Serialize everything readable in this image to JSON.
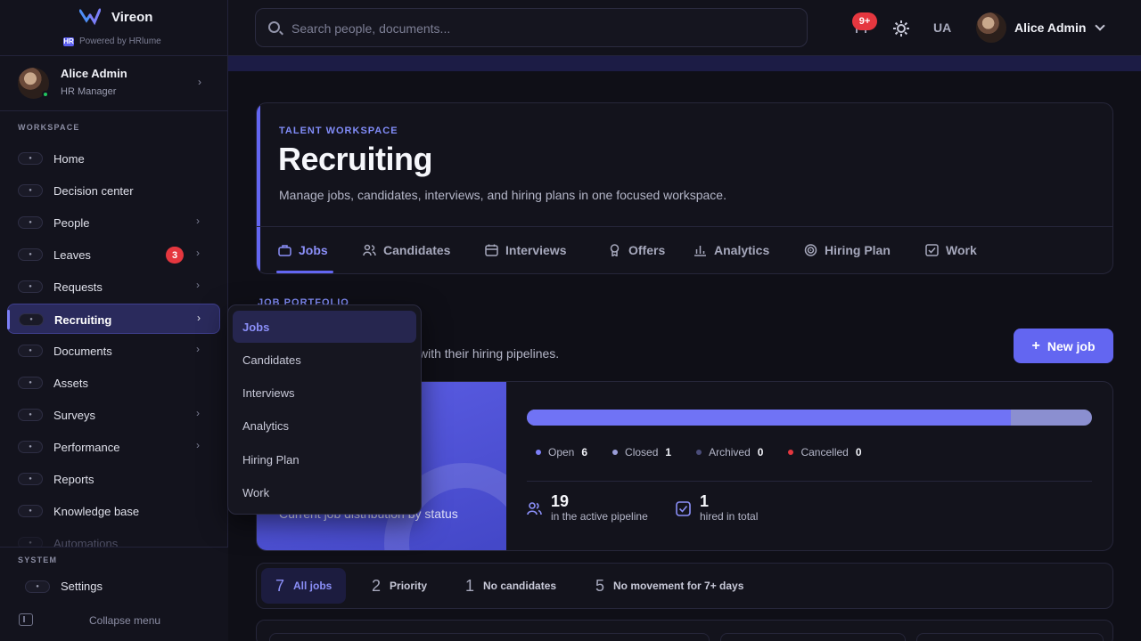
{
  "brand": {
    "name": "Vireon",
    "powered_by": "Powered by HRlume",
    "powered_icon": "HR"
  },
  "sidebar_user": {
    "name": "Alice Admin",
    "role": "HR Manager"
  },
  "workspace_label": "WORKSPACE",
  "nav": [
    {
      "label": "Home",
      "icon": "home-icon",
      "chevron": false
    },
    {
      "label": "Decision center",
      "icon": "target-icon",
      "chevron": false
    },
    {
      "label": "People",
      "icon": "people-icon",
      "chevron": true
    },
    {
      "label": "Leaves",
      "icon": "calendar-icon",
      "chevron": true,
      "badge": "3"
    },
    {
      "label": "Requests",
      "icon": "send-icon",
      "chevron": true
    },
    {
      "label": "Recruiting",
      "icon": "briefcase-icon",
      "chevron": true,
      "active": true
    },
    {
      "label": "Documents",
      "icon": "document-icon",
      "chevron": true
    },
    {
      "label": "Assets",
      "icon": "box-icon",
      "chevron": false
    },
    {
      "label": "Surveys",
      "icon": "survey-icon",
      "chevron": true
    },
    {
      "label": "Performance",
      "icon": "chart-icon",
      "chevron": true
    },
    {
      "label": "Reports",
      "icon": "report-icon",
      "chevron": false
    },
    {
      "label": "Knowledge base",
      "icon": "book-icon",
      "chevron": false
    },
    {
      "label": "Automations",
      "icon": "bolt-icon",
      "chevron": false,
      "faded": true
    }
  ],
  "system_label": "SYSTEM",
  "settings_label": "Settings",
  "collapse_label": "Collapse menu",
  "topbar": {
    "search_placeholder": "Search people, documents...",
    "notif_badge": "9+",
    "lang": "UA",
    "user_name": "Alice Admin"
  },
  "hero": {
    "eyebrow": "TALENT WORKSPACE",
    "title": "Recruiting",
    "description": "Manage jobs, candidates, interviews, and hiring plans in one focused workspace."
  },
  "tabs": [
    {
      "label": "Jobs",
      "icon": "briefcase-icon",
      "active": true
    },
    {
      "label": "Candidates",
      "icon": "people-icon"
    },
    {
      "label": "Interviews",
      "icon": "calendar-icon"
    },
    {
      "label": "Offers",
      "icon": "award-icon"
    },
    {
      "label": "Analytics",
      "icon": "bar-chart-icon"
    },
    {
      "label": "Hiring Plan",
      "icon": "target-icon"
    },
    {
      "label": "Work",
      "icon": "checkbox-icon"
    }
  ],
  "portfolio": {
    "label": "JOB PORTFOLIO",
    "description_visible": "with their hiring pipelines.",
    "new_job_label": "New job"
  },
  "summary": {
    "caption": "Current job distribution by status",
    "progress_open_fraction": 0.857,
    "legend": [
      {
        "label": "Open",
        "value": "6",
        "color": "#7c7ff8"
      },
      {
        "label": "Closed",
        "value": "1",
        "color": "#9a9dd8"
      },
      {
        "label": "Archived",
        "value": "0",
        "color": "#4b4d7a"
      },
      {
        "label": "Cancelled",
        "value": "0",
        "color": "#e5373f"
      }
    ],
    "stats": [
      {
        "value": "19",
        "label": "in the active pipeline",
        "icon": "people-icon"
      },
      {
        "value": "1",
        "label": "hired in total",
        "icon": "check-square-icon"
      }
    ]
  },
  "filters": [
    {
      "count": "7",
      "label": "All jobs",
      "active": true
    },
    {
      "count": "2",
      "label": "Priority"
    },
    {
      "count": "1",
      "label": "No candidates"
    },
    {
      "count": "5",
      "label": "No movement for 7+ days"
    }
  ],
  "dropdown": [
    {
      "label": "Jobs",
      "active": true
    },
    {
      "label": "Candidates"
    },
    {
      "label": "Interviews"
    },
    {
      "label": "Analytics"
    },
    {
      "label": "Hiring Plan"
    },
    {
      "label": "Work"
    }
  ],
  "colors": {
    "accent": "#6366f1",
    "badge_red": "#e5373f",
    "online": "#22c55e"
  }
}
